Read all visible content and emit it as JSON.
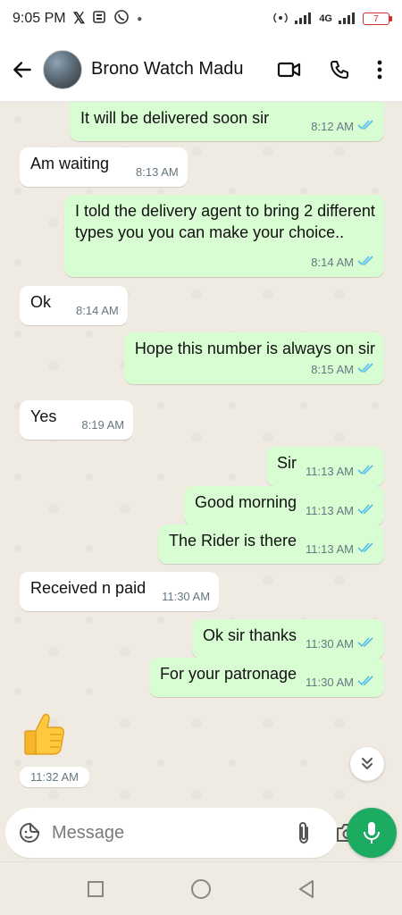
{
  "status_bar": {
    "time": "9:05 PM",
    "network": "4G",
    "battery": "7"
  },
  "header": {
    "contact_name": "Brono Watch Madu"
  },
  "messages": [
    {
      "direction": "out",
      "text": "It will be delivered soon sir",
      "time": "8:12 AM",
      "status": "read"
    },
    {
      "direction": "in",
      "text": "Am waiting",
      "time": "8:13 AM"
    },
    {
      "direction": "out",
      "text": "I told the delivery agent to bring 2 different types you you can make your choice..",
      "time": "8:14 AM",
      "status": "read"
    },
    {
      "direction": "in",
      "text": "Ok",
      "time": "8:14 AM"
    },
    {
      "direction": "out",
      "text": "Hope this number is always on sir",
      "time": "8:15 AM",
      "status": "read"
    },
    {
      "direction": "in",
      "text": "Yes",
      "time": "8:19 AM"
    },
    {
      "direction": "out",
      "text": "Sir",
      "time": "11:13 AM",
      "status": "read"
    },
    {
      "direction": "out",
      "text": "Good morning",
      "time": "11:13 AM",
      "status": "read"
    },
    {
      "direction": "out",
      "text": "The Rider is there",
      "time": "11:13 AM",
      "status": "read"
    },
    {
      "direction": "in",
      "text": "Received n paid",
      "time": "11:30 AM"
    },
    {
      "direction": "out",
      "text": "Ok sir thanks",
      "time": "11:30 AM",
      "status": "read"
    },
    {
      "direction": "out",
      "text": "For your patronage",
      "time": "11:30 AM",
      "status": "read"
    }
  ],
  "sticker": {
    "emoji": "👍",
    "time": "11:32 AM"
  },
  "composer": {
    "placeholder": "Message"
  },
  "colors": {
    "outgoing_bubble": "#d9fdd3",
    "incoming_bubble": "#ffffff",
    "read_ticks": "#53bdeb",
    "accent_green": "#1daa61",
    "chat_background": "#efeae2"
  }
}
